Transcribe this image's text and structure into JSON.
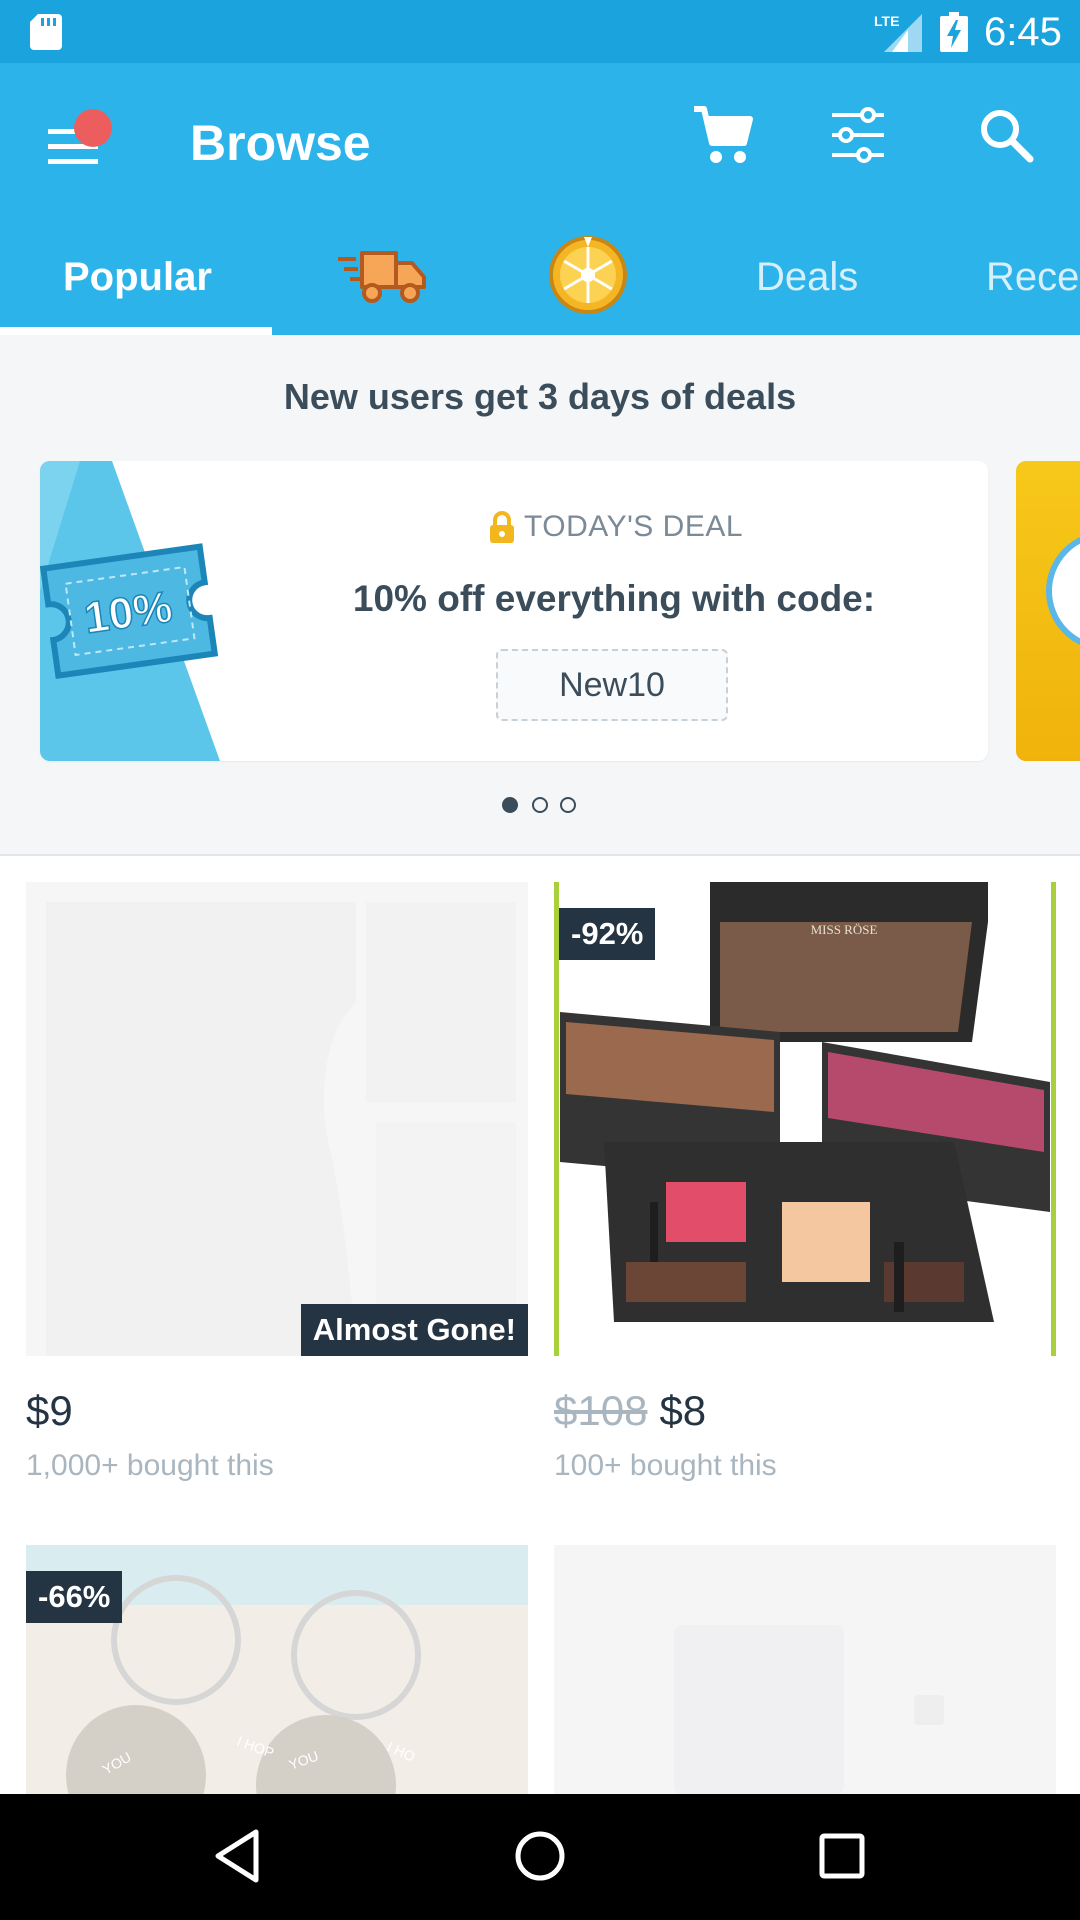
{
  "status_bar": {
    "time": "6:45",
    "network": "LTE",
    "icons": [
      "sd-card-icon",
      "lte-signal-icon",
      "battery-charging-icon"
    ]
  },
  "header": {
    "title": "Browse",
    "icons": [
      "menu-icon",
      "cart-icon",
      "filter-icon",
      "search-icon"
    ],
    "accent_color": "#2cb3ea",
    "notification_color": "#ec5e5e"
  },
  "tabs": [
    {
      "label": "Popular",
      "selected": true
    },
    {
      "icon": "delivery-truck-icon",
      "selected": false
    },
    {
      "icon": "prize-wheel-icon",
      "selected": false
    },
    {
      "label": "Deals",
      "selected": false
    },
    {
      "label": "Rece",
      "selected": false
    }
  ],
  "promo": {
    "headline": "New users get 3 days of deals",
    "card": {
      "ticket_text": "10%",
      "label": "TODAY'S DEAL",
      "title": "10% off everything with code:",
      "code": "New10"
    },
    "pager": {
      "count": 3,
      "active_index": 0
    }
  },
  "products": [
    {
      "price": "$9",
      "old_price": "",
      "bought": "1,000+ bought this",
      "badge": "Almost Gone!",
      "discount": ""
    },
    {
      "price": "$8",
      "old_price": "$108",
      "bought": "100+ bought this",
      "badge": "",
      "discount": "-92%",
      "image_brand": "MISS RÖSE"
    },
    {
      "price": "",
      "old_price": "",
      "bought": "",
      "badge": "",
      "discount": "-66%",
      "image_text": [
        "YOU",
        "I HOP",
        "YOU",
        "I HO"
      ]
    },
    {
      "price": "",
      "old_price": "",
      "bought": "",
      "badge": "",
      "discount": ""
    }
  ],
  "nav_bar": {
    "icons": [
      "back-icon",
      "home-icon",
      "recent-apps-icon"
    ]
  }
}
